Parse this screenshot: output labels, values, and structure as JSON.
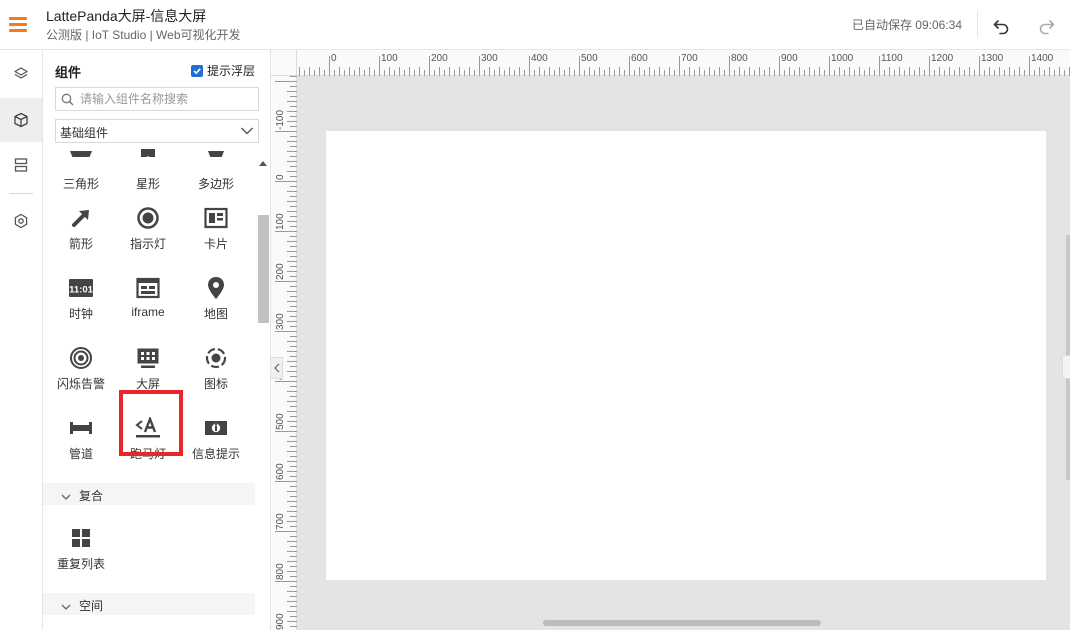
{
  "header": {
    "title": "LattePanda大屏-信息大屏",
    "subtitle": "公测版 | IoT Studio | Web可视化开发",
    "autosave": "已自动保存 09:06:34"
  },
  "rail": {
    "items": [
      {
        "icon": "layers-icon"
      },
      {
        "icon": "cube-icon",
        "active": true
      },
      {
        "icon": "data-stack-icon"
      },
      {
        "icon": "hexagon-settings-icon"
      }
    ]
  },
  "panel": {
    "title": "组件",
    "hint_label": "提示浮层",
    "hint_checked": true,
    "search_placeholder": "请输入组件名称搜索",
    "category_selected": "基础组件",
    "items": [
      {
        "label": "三角形",
        "icon": "triangle-icon"
      },
      {
        "label": "星形",
        "icon": "star-icon"
      },
      {
        "label": "多边形",
        "icon": "polygon-icon"
      },
      {
        "label": "箭形",
        "icon": "arrow-icon"
      },
      {
        "label": "指示灯",
        "icon": "indicator-light-icon"
      },
      {
        "label": "卡片",
        "icon": "card-icon"
      },
      {
        "label": "时钟",
        "icon": "clock-icon",
        "icon_text": "11:01"
      },
      {
        "label": "iframe",
        "icon": "iframe-icon"
      },
      {
        "label": "地图",
        "icon": "map-pin-icon"
      },
      {
        "label": "闪烁告警",
        "icon": "flash-alarm-icon"
      },
      {
        "label": "大屏",
        "icon": "big-screen-icon",
        "highlighted": true
      },
      {
        "label": "图标",
        "icon": "icon-icon"
      },
      {
        "label": "管道",
        "icon": "pipe-icon"
      },
      {
        "label": "跑马灯",
        "icon": "marquee-icon"
      },
      {
        "label": "信息提示",
        "icon": "info-tip-icon"
      }
    ],
    "groups": [
      {
        "label": "复合",
        "items": [
          {
            "label": "重复列表",
            "icon": "repeat-list-icon"
          }
        ]
      },
      {
        "label": "空间",
        "items": []
      }
    ]
  },
  "canvas": {
    "ruler_h_labels": [
      "0",
      "100",
      "200",
      "300",
      "400",
      "500",
      "600",
      "700",
      "800",
      "900",
      "1000",
      "1100",
      "1200",
      "1300",
      "1400"
    ],
    "ruler_v_labels": [
      "-100",
      "0",
      "100",
      "200",
      "300",
      "400",
      "500",
      "600",
      "700",
      "800",
      "900"
    ]
  },
  "colors": {
    "accent_orange": "#f47a20",
    "highlight_red": "#e8262b",
    "checkbox_blue": "#1f6fd8",
    "canvas_bg": "#e4e4e4"
  }
}
